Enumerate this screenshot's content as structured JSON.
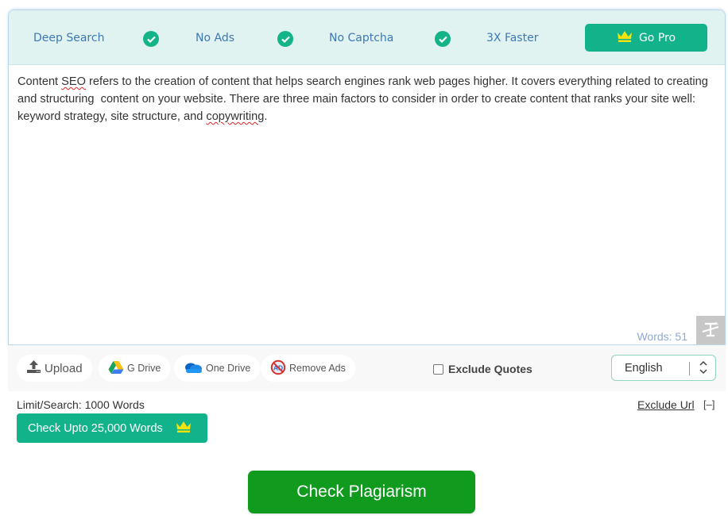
{
  "features": {
    "items": [
      {
        "label": "Deep Search",
        "icon": "check-circle-icon"
      },
      {
        "label": "No Ads",
        "icon": "check-circle-icon"
      },
      {
        "label": "No Captcha",
        "icon": "check-circle-icon"
      },
      {
        "label": "3X Faster"
      }
    ],
    "go_pro_label": "Go Pro",
    "go_pro_icon": "crown-icon"
  },
  "editor": {
    "text_parts": [
      "Content ",
      "SEO",
      " refers to the creation of content that helps search engines rank web pages higher. It covers everything related to creating and structuring  content on your website. There are three main factors to consider in order to create content that ranks your site well: keyword strategy, site structure, and ",
      "copywriting",
      "."
    ],
    "misspelled_words": [
      "SEO",
      "copywriting"
    ],
    "word_count_label": "Words: 51"
  },
  "toolbar": {
    "upload_label": "Upload",
    "gdrive_label": "G Drive",
    "onedrive_label": "One Drive",
    "remove_ads_label": "Remove Ads",
    "exclude_quotes_label": "Exclude Quotes",
    "exclude_quotes_checked": false,
    "language_selected": "English"
  },
  "limits": {
    "limit_text": "Limit/Search: 1000 Words",
    "upgrade_label": "Check Upto 25,000 Words",
    "exclude_url_label": "Exclude Url",
    "exclude_url_toggle": "[–]"
  },
  "actions": {
    "check_label": "Check Plagiarism"
  },
  "colors": {
    "brand_teal": "#12b28b",
    "check_green": "#119b1e",
    "feature_text": "#3d78b5",
    "feature_bar_bg": "#e0f3f1",
    "crown_yellow": "#f4e20a"
  }
}
